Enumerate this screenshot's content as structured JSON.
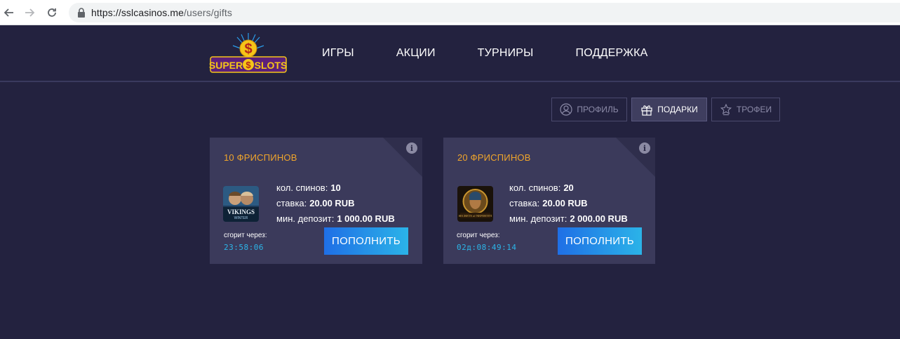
{
  "browser": {
    "url_domain": "https://sslcasinos.me",
    "url_path": "/users/gifts"
  },
  "header": {
    "logo_text": "SUPER$SLOTS",
    "nav": [
      "ИГРЫ",
      "АКЦИИ",
      "ТУРНИРЫ",
      "ПОДДЕРЖКА"
    ]
  },
  "tabs": [
    {
      "label": "ПРОФИЛЬ",
      "icon": "profile-icon",
      "active": false
    },
    {
      "label": "ПОДАРКИ",
      "icon": "gift-icon",
      "active": true
    },
    {
      "label": "ТРОФЕИ",
      "icon": "trophy-icon",
      "active": false
    }
  ],
  "cards": [
    {
      "title": "10 ФРИСПИНОВ",
      "game_thumb_text": "VIKINGS WINTER",
      "spins_label": "кол. спинов:",
      "spins_value": "10",
      "bet_label": "ставка:",
      "bet_value": "20.00 RUB",
      "min_deposit_label": "мин. депозит:",
      "min_deposit_value": "1 000.00 RUB",
      "expire_label": "сгорит через:",
      "timer": "23:58:06",
      "button": "ПОПОЛНИТЬ",
      "info_icon": "i"
    },
    {
      "title": "20 ФРИСПИНОВ",
      "game_thumb_text": "SECRETS OF NEFERTITI",
      "spins_label": "кол. спинов:",
      "spins_value": "20",
      "bet_label": "ставка:",
      "bet_value": "20.00 RUB",
      "min_deposit_label": "мин. депозит:",
      "min_deposit_value": "2 000.00 RUB",
      "expire_label": "сгорит через:",
      "timer": "02д:08:49:14",
      "button": "ПОПОЛНИТЬ",
      "info_icon": "i"
    }
  ],
  "colors": {
    "background": "#23223f",
    "card": "#3b3a5b",
    "title_accent": "#f0a52b",
    "timer": "#2cb5e8",
    "button_start": "#1f6fe6",
    "button_end": "#2bb3e8"
  }
}
